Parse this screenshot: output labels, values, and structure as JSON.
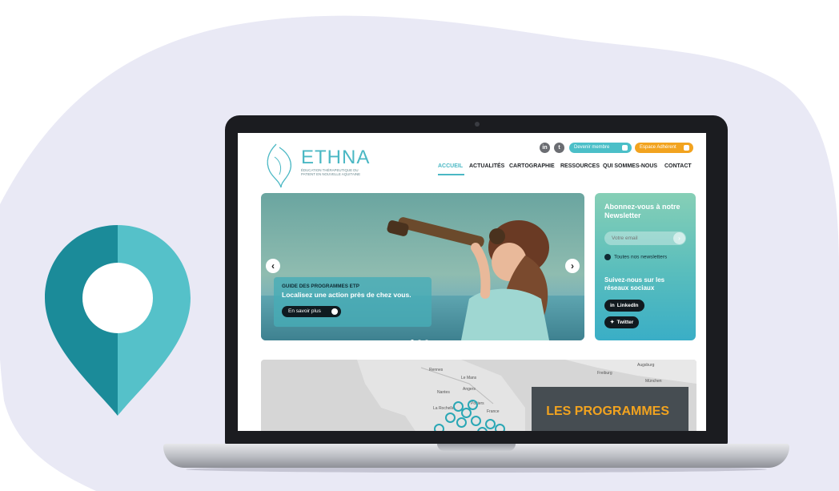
{
  "site": {
    "logo": {
      "word": "ETHNA",
      "subtitle": "Éducation thérapeutique du patient en Nouvelle Aquitaine"
    },
    "social": [
      {
        "name": "linkedin",
        "glyph": "in"
      },
      {
        "name": "twitter",
        "glyph": "t"
      }
    ],
    "buttons": {
      "member": "Devenir membre",
      "adherent": "Espace Adhérent"
    },
    "nav": [
      "ACCUEIL",
      "ACTUALITÉS",
      "CARTOGRAPHIE",
      "RESSOURCES",
      "QUI SOMMES-NOUS",
      "CONTACT"
    ],
    "active_nav": "ACCUEIL",
    "hero": {
      "caption_title": "GUIDE DES PROGRAMMES ETP",
      "caption_text": "Localisez une action près de chez vous.",
      "button": "En savoir plus",
      "prev": "‹",
      "next": "›",
      "slides": 3,
      "current_slide": 1
    },
    "sidebar": {
      "newsletter_title": "Abonnez-vous à notre Newsletter",
      "email_placeholder": "Votre email",
      "go": "›",
      "all_newsletters": "Toutes nos newsletters",
      "social_title": "Suivez-nous sur les réseaux sociaux",
      "linkedin": "LinkedIn",
      "twitter": "Twitter"
    },
    "map": {
      "labels": [
        "Rennes",
        "Le Mans",
        "Nantes",
        "Angers",
        "Poitiers",
        "La Rochelle",
        "France",
        "Augsburg",
        "München",
        "Freiburg"
      ],
      "box_title": "LES PROGRAMMES"
    }
  },
  "colors": {
    "teal": "#4bb8c4",
    "orange": "#f2a31f",
    "background_blob": "#e9e9f5"
  }
}
